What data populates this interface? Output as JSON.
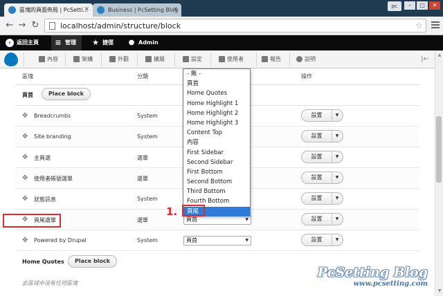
{
  "browser": {
    "tabs": [
      {
        "label": "區塊的頁面佈局 | PcSetti...",
        "active": true,
        "favicon_color": "#2a7fc1"
      },
      {
        "label": "Business | PcSetting Blog",
        "active": false,
        "favicon_color": "#2a7fc1"
      }
    ],
    "user_label": "pc",
    "window_controls": [
      "–",
      "□",
      "✕"
    ],
    "url": "localhost/admin/structure/block"
  },
  "toolbar": {
    "items": [
      {
        "label": "返回主頁",
        "icon": "back-arrow-icon"
      },
      {
        "label": "管理",
        "icon": "menu-icon"
      },
      {
        "label": "捷徑",
        "icon": "star-icon"
      },
      {
        "label": "Admin",
        "icon": "user-icon"
      }
    ]
  },
  "tray": {
    "items": [
      {
        "label": "內容",
        "icon": "content-icon"
      },
      {
        "label": "架構",
        "icon": "structure-icon"
      },
      {
        "label": "外觀",
        "icon": "appearance-icon"
      },
      {
        "label": "擴展",
        "icon": "extend-icon"
      },
      {
        "label": "設定",
        "icon": "wrench-icon"
      },
      {
        "label": "使用者",
        "icon": "people-icon"
      },
      {
        "label": "報告",
        "icon": "reports-icon"
      },
      {
        "label": "說明",
        "icon": "help-icon"
      }
    ]
  },
  "table": {
    "headers": {
      "block": "區塊",
      "category": "分類",
      "region": "區域",
      "operations": "操作"
    }
  },
  "regions": [
    {
      "title": "頁首",
      "place_button": "Place block"
    },
    {
      "title": "Home Quotes",
      "place_button": "Place block"
    }
  ],
  "blocks": [
    {
      "name": "Breadcrumbs",
      "category": "System",
      "region": "",
      "op": "設置"
    },
    {
      "name": "Site branding",
      "category": "System",
      "region": "",
      "op": "設置"
    },
    {
      "name": "主頁選",
      "category": "選單",
      "region": "",
      "op": "設置"
    },
    {
      "name": "使用者帳號選單",
      "category": "選單",
      "region": "",
      "op": "設置"
    },
    {
      "name": "狀態訊息",
      "category": "System",
      "region": "",
      "op": "設置"
    },
    {
      "name": "頁尾選單",
      "category": "選單",
      "region": "頁首",
      "op": "設置"
    },
    {
      "name": "Powered by Drupal",
      "category": "System",
      "region": "頁首",
      "op": "設置"
    }
  ],
  "empty_note": "此區域中沒有任何區塊",
  "dropdown": {
    "options": [
      "- 無 -",
      "頁首",
      "Home Quotes",
      "Home Highlight 1",
      "Home Highlight 2",
      "Home Highlight 3",
      "Content Top",
      "內容",
      "First Sidebar",
      "Second Sidebar",
      "First Bottom",
      "Second Bottom",
      "Third Bottom",
      "Fourth Bottom",
      "頁尾"
    ],
    "selected": "頁尾"
  },
  "annotation": {
    "step": "1."
  },
  "watermark": {
    "title": "PcSetting Blog",
    "url": "www.pcsetting.com"
  },
  "colors": {
    "accent": "#e0282d",
    "selection": "#2f7ad6",
    "toolbar": "#0b0b0b",
    "drupal_blue": "#0678be"
  }
}
